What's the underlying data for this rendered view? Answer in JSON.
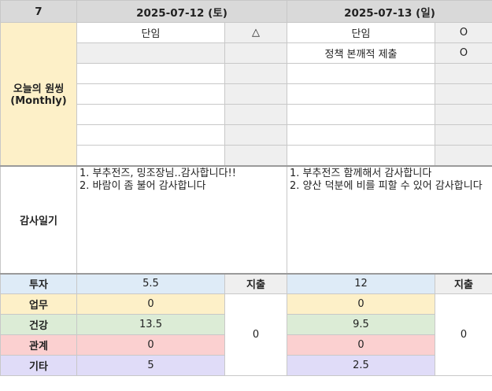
{
  "header": {
    "week_number": "7",
    "day1_date": "2025-07-12 (토)",
    "day2_date": "2025-07-13 (일)"
  },
  "monthly": {
    "label_line1": "오늘의 원씽",
    "label_line2": "(Monthly)",
    "day1": [
      {
        "task": "단임",
        "status": "△"
      }
    ],
    "day2": [
      {
        "task": "단임",
        "status": "O"
      },
      {
        "task": "정책 본깨적 제출",
        "status": "O"
      }
    ]
  },
  "gratitude": {
    "label": "감사일기",
    "day1_lines": [
      "1. 부추전즈, 밍조장님..감사합니다!!",
      "2. 바람이 좀 불어 감사합니다"
    ],
    "day2_lines": [
      "1. 부추전즈 함께해서 감사합니다",
      "2. 양산 덕분에 비를 피할 수 있어 감사합니다"
    ]
  },
  "stats": {
    "expense_label": "지출",
    "rows": [
      {
        "label": "투자",
        "day1": "5.5",
        "day2": "12"
      },
      {
        "label": "업무",
        "day1": "0",
        "day2": "0"
      },
      {
        "label": "건강",
        "day1": "13.5",
        "day2": "9.5"
      },
      {
        "label": "관계",
        "day1": "0",
        "day2": "0"
      },
      {
        "label": "기타",
        "day1": "5",
        "day2": "2.5"
      }
    ],
    "day1_expense": "0",
    "day2_expense": "0"
  },
  "colors": {
    "header_gray": "#d9d9d9",
    "side_yellow": "#fdf0c8",
    "invest_blue": "#deebf7",
    "health_green": "#dcecd6",
    "relation_pink": "#fbd0d0",
    "other_purple": "#e0dcf8"
  }
}
